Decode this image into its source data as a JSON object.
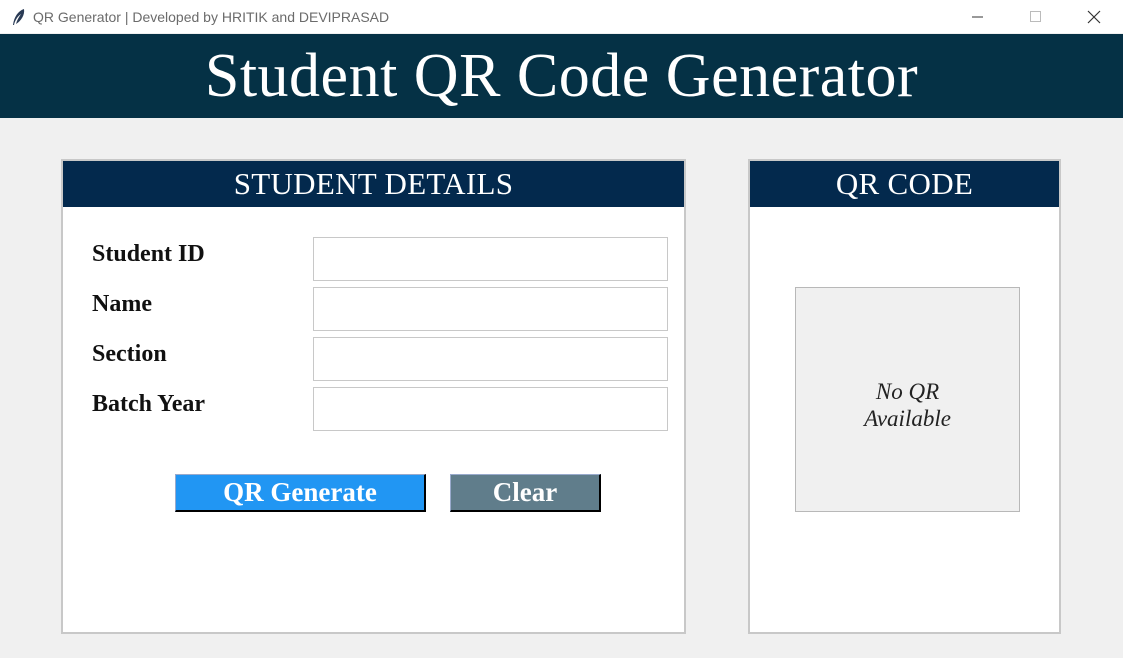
{
  "window": {
    "title": "QR Generator | Developed by HRITIK and DEVIPRASAD",
    "icon": "feather-icon"
  },
  "header": {
    "title": "Student QR Code Generator"
  },
  "details": {
    "heading": "STUDENT DETAILS",
    "fields": [
      {
        "label": "Student ID",
        "value": ""
      },
      {
        "label": "Name",
        "value": ""
      },
      {
        "label": "Section",
        "value": ""
      },
      {
        "label": "Batch Year",
        "value": ""
      }
    ],
    "generate_label": "QR Generate",
    "clear_label": "Clear"
  },
  "qr": {
    "heading": "QR CODE",
    "placeholder": "No QR\nAvailable"
  },
  "colors": {
    "header_bg": "#053145",
    "panel_head_bg": "#03294d",
    "generate_btn": "#2196f3",
    "clear_btn": "#607d8b"
  }
}
